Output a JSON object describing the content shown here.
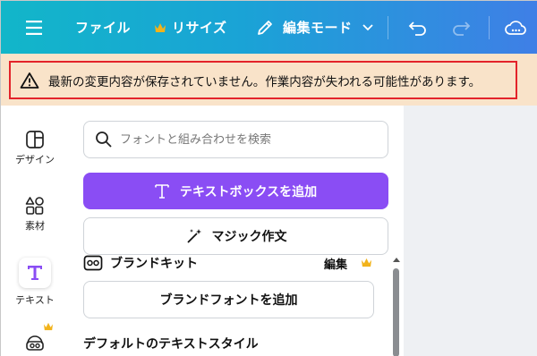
{
  "header": {
    "file_label": "ファイル",
    "resize_label": "リサイズ",
    "edit_mode_label": "編集モード"
  },
  "banner": {
    "message": "最新の変更内容が保存されていません。作業内容が失われる可能性があります。"
  },
  "rail": {
    "design": "デザイン",
    "elements": "素材",
    "text": "テキスト"
  },
  "panel": {
    "search_placeholder": "フォントと組み合わせを検索",
    "add_textbox": "テキストボックスを追加",
    "magic_write": "マジック作文",
    "brand_kit_title": "ブランドキット",
    "brand_kit_edit": "編集",
    "add_brand_font": "ブランドフォントを追加",
    "default_text_styles": "デフォルトのテキストスタイル"
  },
  "colors": {
    "header_gradient_start": "#12b6c9",
    "header_gradient_end": "#3f7fe6",
    "banner_bg": "#f9e3c9",
    "banner_border": "#e3232a",
    "primary_purple": "#8a4df4",
    "crown": "#f2b31b"
  },
  "icons": {
    "menu": "menu-icon",
    "crown": "crown-icon",
    "pencil": "pencil-icon",
    "chevron": "chevron-down-icon",
    "undo": "undo-icon",
    "redo": "redo-icon",
    "cloud": "cloud-sync-icon",
    "warning": "warning-icon",
    "search": "search-icon",
    "text_t": "text-t-icon",
    "magic_wand": "magic-wand-icon",
    "brand_kit": "brand-kit-icon"
  }
}
